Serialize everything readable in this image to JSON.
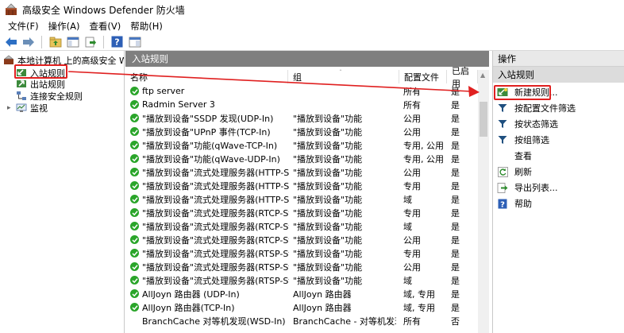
{
  "window": {
    "title": "高级安全 Windows Defender 防火墙"
  },
  "menu": [
    "文件(F)",
    "操作(A)",
    "查看(V)",
    "帮助(H)"
  ],
  "tree": {
    "root": "本地计算机 上的高级安全 Windc",
    "items": [
      "入站规则",
      "出站规则",
      "连接安全规则",
      "监视"
    ]
  },
  "center": {
    "header": "入站规则",
    "columns": [
      "名称",
      "组",
      "配置文件",
      "已启用"
    ],
    "rows": [
      {
        "name": "ftp server",
        "group": "",
        "profile": "所有",
        "enabled": "是",
        "icon": "check"
      },
      {
        "name": "Radmin Server 3",
        "group": "",
        "profile": "所有",
        "enabled": "是",
        "icon": "check"
      },
      {
        "name": "\"播放到设备\"SSDP 发现(UDP-In)",
        "group": "\"播放到设备\"功能",
        "profile": "公用",
        "enabled": "是",
        "icon": "check"
      },
      {
        "name": "\"播放到设备\"UPnP 事件(TCP-In)",
        "group": "\"播放到设备\"功能",
        "profile": "公用",
        "enabled": "是",
        "icon": "check"
      },
      {
        "name": "\"播放到设备\"功能(qWave-TCP-In)",
        "group": "\"播放到设备\"功能",
        "profile": "专用, 公用",
        "enabled": "是",
        "icon": "check"
      },
      {
        "name": "\"播放到设备\"功能(qWave-UDP-In)",
        "group": "\"播放到设备\"功能",
        "profile": "专用, 公用",
        "enabled": "是",
        "icon": "check"
      },
      {
        "name": "\"播放到设备\"流式处理服务器(HTTP-Stre...",
        "group": "\"播放到设备\"功能",
        "profile": "公用",
        "enabled": "是",
        "icon": "check"
      },
      {
        "name": "\"播放到设备\"流式处理服务器(HTTP-Stre...",
        "group": "\"播放到设备\"功能",
        "profile": "专用",
        "enabled": "是",
        "icon": "check"
      },
      {
        "name": "\"播放到设备\"流式处理服务器(HTTP-Stre...",
        "group": "\"播放到设备\"功能",
        "profile": "域",
        "enabled": "是",
        "icon": "check"
      },
      {
        "name": "\"播放到设备\"流式处理服务器(RTCP-Stre...",
        "group": "\"播放到设备\"功能",
        "profile": "专用",
        "enabled": "是",
        "icon": "check"
      },
      {
        "name": "\"播放到设备\"流式处理服务器(RTCP-Stre...",
        "group": "\"播放到设备\"功能",
        "profile": "域",
        "enabled": "是",
        "icon": "check"
      },
      {
        "name": "\"播放到设备\"流式处理服务器(RTCP-Stre...",
        "group": "\"播放到设备\"功能",
        "profile": "公用",
        "enabled": "是",
        "icon": "check"
      },
      {
        "name": "\"播放到设备\"流式处理服务器(RTSP-Stre...",
        "group": "\"播放到设备\"功能",
        "profile": "专用",
        "enabled": "是",
        "icon": "check"
      },
      {
        "name": "\"播放到设备\"流式处理服务器(RTSP-Stre...",
        "group": "\"播放到设备\"功能",
        "profile": "公用",
        "enabled": "是",
        "icon": "check"
      },
      {
        "name": "\"播放到设备\"流式处理服务器(RTSP-Stre...",
        "group": "\"播放到设备\"功能",
        "profile": "域",
        "enabled": "是",
        "icon": "check"
      },
      {
        "name": "AllJoyn 路由器 (UDP-In)",
        "group": "AllJoyn 路由器",
        "profile": "域, 专用",
        "enabled": "是",
        "icon": "check"
      },
      {
        "name": "AllJoyn 路由器(TCP-In)",
        "group": "AllJoyn 路由器",
        "profile": "域, 专用",
        "enabled": "是",
        "icon": "check"
      },
      {
        "name": "BranchCache 对等机发现(WSD-In)",
        "group": "BranchCache - 对等机发现(...",
        "profile": "所有",
        "enabled": "否",
        "icon": "none"
      }
    ]
  },
  "actions": {
    "header": "操作",
    "section": "入站规则",
    "items": [
      {
        "label": "新建规则...",
        "icon": "new-rule-icon"
      },
      {
        "label": "按配置文件筛选",
        "icon": "filter-icon"
      },
      {
        "label": "按状态筛选",
        "icon": "filter-icon"
      },
      {
        "label": "按组筛选",
        "icon": "filter-icon"
      },
      {
        "label": "查看",
        "icon": "none"
      },
      {
        "label": "刷新",
        "icon": "refresh-icon"
      },
      {
        "label": "导出列表...",
        "icon": "export-icon"
      },
      {
        "label": "帮助",
        "icon": "help-icon"
      }
    ]
  },
  "colors": {
    "annotation": "#e02020",
    "header_bg": "#7f7f7f",
    "check_green": "#2aa52a"
  }
}
